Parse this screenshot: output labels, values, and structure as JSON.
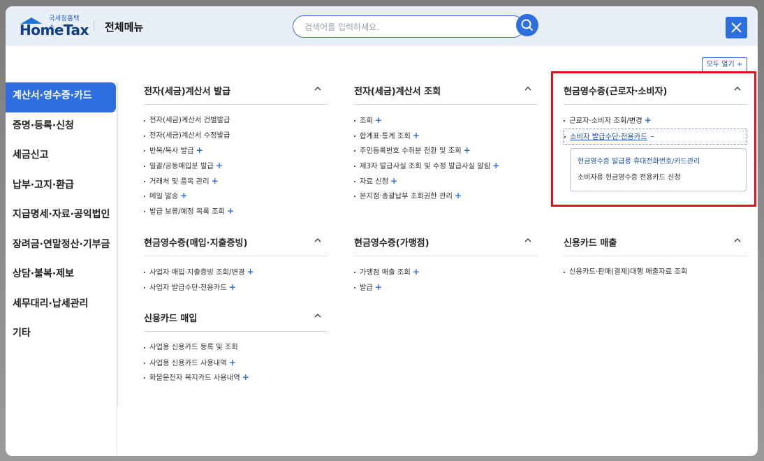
{
  "header": {
    "logo_ko": "국세청홈택스",
    "logo_en": "HomeTax",
    "title": "전체메뉴",
    "search_placeholder": "검색어를 입력하세요."
  },
  "open_all_label": "모두 열기 +",
  "sidebar": [
    {
      "label": "계산서·영수증·카드",
      "active": true
    },
    {
      "label": "증명·등록·신청"
    },
    {
      "label": "세금신고"
    },
    {
      "label": "납부·고지·환급"
    },
    {
      "label": "지급명세·자료·공익법인"
    },
    {
      "label": "장려금·연말정산·기부금"
    },
    {
      "label": "상담·불복·제보"
    },
    {
      "label": "세무대리·납세관리"
    },
    {
      "label": "기타"
    }
  ],
  "sections": [
    {
      "title": "전자(세금)계산서 발급",
      "items": [
        {
          "label": "전자(세금)계산서 건별발급",
          "plus": false
        },
        {
          "label": "전자(세금)계산서 수정발급",
          "plus": false
        },
        {
          "label": "반복/복사 발급",
          "plus": true
        },
        {
          "label": "일괄/공동매입분 발급",
          "plus": true
        },
        {
          "label": "거래처 및 품목 관리",
          "plus": true
        },
        {
          "label": "메일 발송",
          "plus": true
        },
        {
          "label": "발급 보류/예정 목록 조회",
          "plus": true
        }
      ]
    },
    {
      "title": "전자(세금)계산서 조회",
      "items": [
        {
          "label": "조회",
          "plus": true
        },
        {
          "label": "합계표·통계 조회",
          "plus": true
        },
        {
          "label": "주민등록번호 수취분 전환 및 조회",
          "plus": true
        },
        {
          "label": "제3자 발급사실 조회 및 수정 발급사실 알림",
          "plus": true
        },
        {
          "label": "자료 신청",
          "plus": true
        },
        {
          "label": "본지점·총괄납부 조회권한 관리",
          "plus": true
        }
      ]
    },
    {
      "title": "현금영수증(근로자·소비자)",
      "items": [
        {
          "label": "근로자·소비자 조회/변경",
          "plus": true
        },
        {
          "label": "소비자 발급수단·전용카드",
          "expanded": true,
          "minus": "–",
          "sub": [
            "현금영수증 발급용 휴대전화번호/카드관리",
            "소비자용 현금영수증 전용카드 신청"
          ]
        }
      ]
    },
    {
      "title": "현금영수증(매입·지출증빙)",
      "items": [
        {
          "label": "사업자 매입·지출증빙 조회/변경",
          "plus": true
        },
        {
          "label": "사업자 발급수단·전용카드",
          "plus": true
        }
      ]
    },
    {
      "title": "현금영수증(가맹점)",
      "items": [
        {
          "label": "가맹점 매출 조회",
          "plus": true
        },
        {
          "label": "발급",
          "plus": true
        }
      ]
    },
    {
      "title": "신용카드 매출",
      "items": [
        {
          "label": "신용카드·판매(결제)대행 매출자료 조회",
          "plus": false
        }
      ]
    },
    {
      "title": "신용카드 매입",
      "items": [
        {
          "label": "사업용 신용카드 등록 및 조회",
          "plus": false
        },
        {
          "label": "사업용 신용카드 사용내역",
          "plus": true
        },
        {
          "label": "화물운전자 복지카드 사용내역",
          "plus": true
        }
      ]
    }
  ],
  "colors": {
    "accent": "#2d6ee0",
    "highlight": "#e4141a"
  }
}
